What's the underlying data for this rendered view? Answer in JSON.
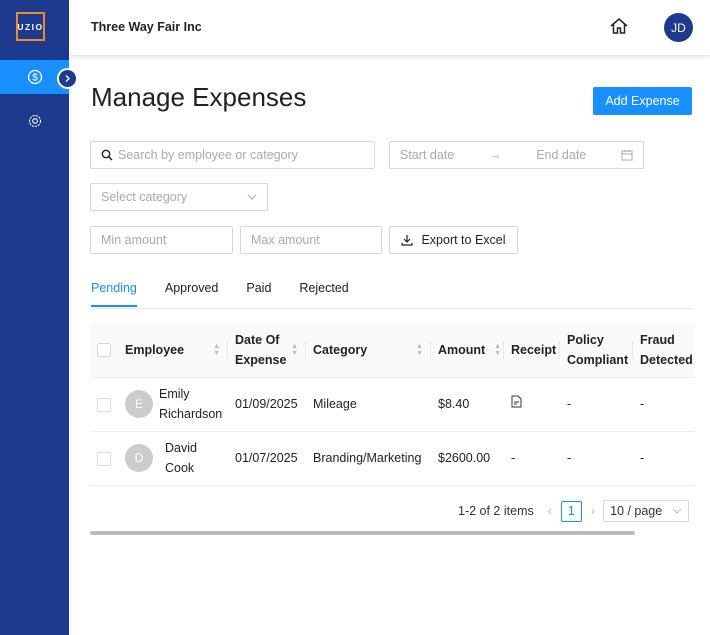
{
  "sidebar": {
    "logo": "UZIO",
    "items": [
      {
        "icon": "dollar-icon",
        "active": true
      },
      {
        "icon": "gear-icon",
        "active": false
      }
    ]
  },
  "header": {
    "company": "Three Way Fair Inc",
    "avatar": "JD"
  },
  "page": {
    "title": "Manage Expenses",
    "add_button": "Add Expense"
  },
  "filters": {
    "search_placeholder": "Search by employee or category",
    "start_date": "Start date",
    "end_date": "End date",
    "category_placeholder": "Select category",
    "min_amount": "Min amount",
    "max_amount": "Max amount",
    "export": "Export to Excel"
  },
  "tabs": [
    "Pending",
    "Approved",
    "Paid",
    "Rejected"
  ],
  "table": {
    "headers": [
      "Employee",
      "Date Of Expense",
      "Category",
      "Amount",
      "Receipt",
      "Policy Compliant",
      "Fraud Detected"
    ],
    "rows": [
      {
        "initial": "E",
        "employee": "Emily Richardson",
        "date": "01/09/2025",
        "category": "Mileage",
        "amount": "$8.40",
        "receipt": "file-icon",
        "policy": "-",
        "fraud": "-"
      },
      {
        "initial": "D",
        "employee": "David Cook",
        "date": "01/07/2025",
        "category": "Branding/Marketing",
        "amount": "$2600.00",
        "receipt": "-",
        "policy": "-",
        "fraud": "-"
      }
    ]
  },
  "pagination": {
    "summary": "1-2 of 2 items",
    "current": "1",
    "page_size": "10 / page"
  }
}
